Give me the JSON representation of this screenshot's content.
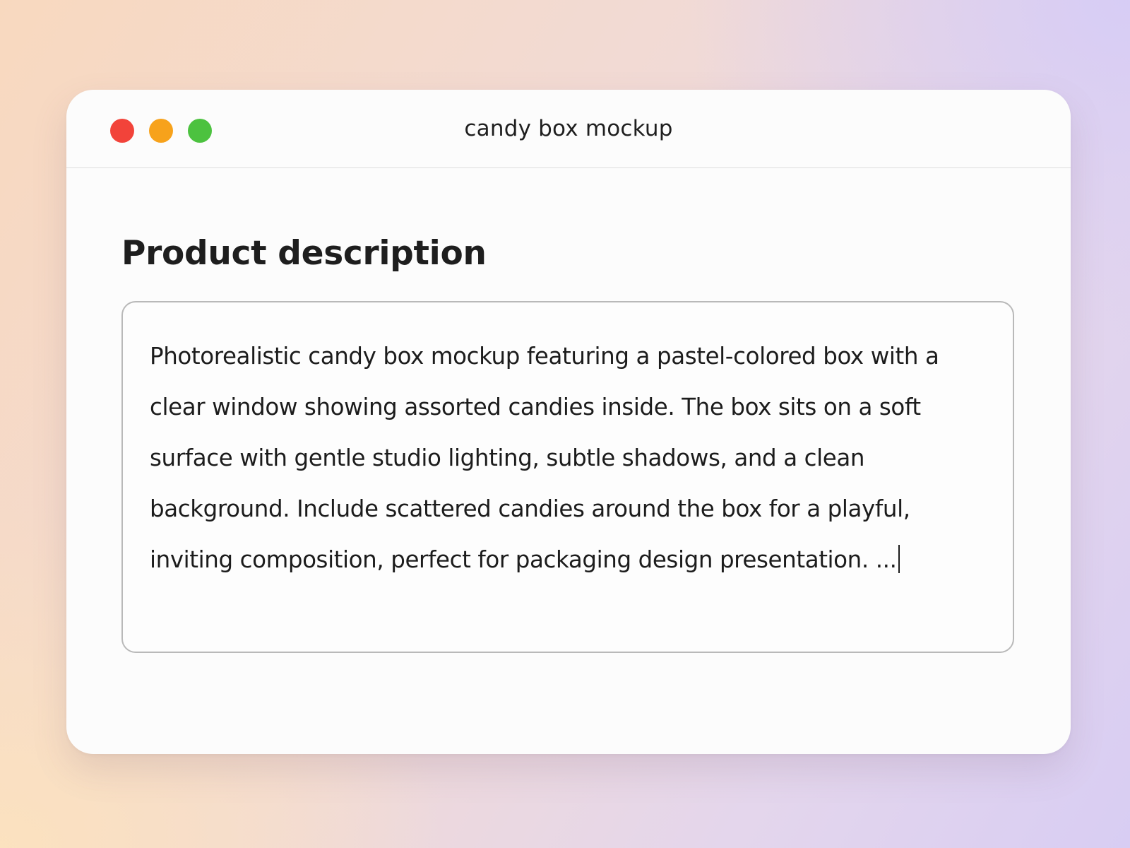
{
  "window": {
    "title": "candy box mockup",
    "controls": {
      "close_color": "#f2433a",
      "minimize_color": "#f7a21b",
      "zoom_color": "#4cc23f"
    }
  },
  "main": {
    "heading": "Product description",
    "description_field": {
      "value": "Photorealistic candy box mockup featuring a pastel-colored box with a clear window showing assorted candies inside. The box sits on a soft surface with gentle studio lighting, subtle shadows, and a clean background. Include scattered candies around the box for a playful, inviting composition, perfect for packaging design presentation. ...",
      "focused": true
    }
  }
}
